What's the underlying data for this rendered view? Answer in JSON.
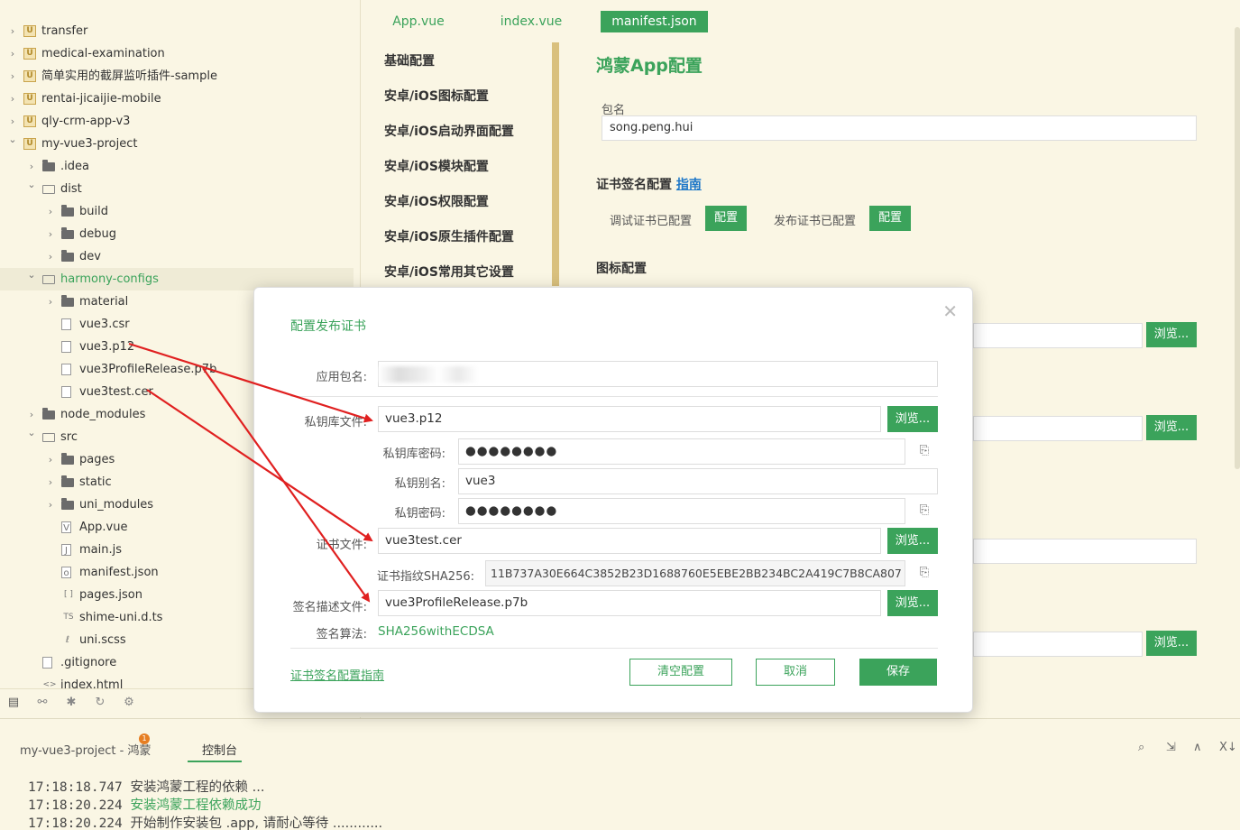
{
  "sidebar": {
    "tree": [
      {
        "label": "transfer",
        "icon": "project-u-icon",
        "chevron": "›"
      },
      {
        "label": "medical-examination",
        "icon": "project-u-icon",
        "chevron": "›"
      },
      {
        "label": "简单实用的截屏监听插件-sample",
        "icon": "project-u-icon",
        "chevron": "›"
      },
      {
        "label": "rentai-jicaijie-mobile",
        "icon": "project-u-icon",
        "chevron": "›"
      },
      {
        "label": "qly-crm-app-v3",
        "icon": "project-u-icon",
        "chevron": "›"
      },
      {
        "label": "my-vue3-project",
        "icon": "project-u-icon",
        "chevron": "⌄"
      },
      {
        "label": ".idea",
        "icon": "folder-icon",
        "chevron": "›"
      },
      {
        "label": "dist",
        "icon": "folder-open-icon",
        "chevron": "⌄"
      },
      {
        "label": "build",
        "icon": "folder-icon",
        "chevron": "›"
      },
      {
        "label": "debug",
        "icon": "folder-icon",
        "chevron": "›"
      },
      {
        "label": "dev",
        "icon": "folder-icon",
        "chevron": "›"
      },
      {
        "label": "harmony-configs",
        "icon": "folder-open-icon",
        "chevron": "⌄"
      },
      {
        "label": "material",
        "icon": "folder-icon",
        "chevron": "›"
      },
      {
        "label": "vue3.csr",
        "icon": "file-icon",
        "chevron": ""
      },
      {
        "label": "vue3.p12",
        "icon": "file-icon",
        "chevron": ""
      },
      {
        "label": "vue3ProfileRelease.p7b",
        "icon": "file-icon",
        "chevron": ""
      },
      {
        "label": "vue3test.cer",
        "icon": "file-icon",
        "chevron": ""
      },
      {
        "label": "node_modules",
        "icon": "folder-icon",
        "chevron": "›"
      },
      {
        "label": "src",
        "icon": "folder-open-icon",
        "chevron": "⌄"
      },
      {
        "label": "pages",
        "icon": "folder-icon",
        "chevron": "›"
      },
      {
        "label": "static",
        "icon": "folder-icon",
        "chevron": "›"
      },
      {
        "label": "uni_modules",
        "icon": "folder-icon",
        "chevron": "›"
      },
      {
        "label": "App.vue",
        "icon": "vue-file-icon",
        "chevron": ""
      },
      {
        "label": "main.js",
        "icon": "js-file-icon",
        "chevron": ""
      },
      {
        "label": "manifest.json",
        "icon": "json-file-icon",
        "chevron": ""
      },
      {
        "label": "pages.json",
        "icon": "json-bracket-icon",
        "chevron": ""
      },
      {
        "label": "shime-uni.d.ts",
        "icon": "ts-file-icon",
        "chevron": ""
      },
      {
        "label": "uni.scss",
        "icon": "scss-file-icon",
        "chevron": ""
      },
      {
        "label": ".gitignore",
        "icon": "file-icon",
        "chevron": ""
      },
      {
        "label": "index.html",
        "icon": "html-file-icon",
        "chevron": ""
      }
    ]
  },
  "editor": {
    "tabs": [
      {
        "label": "App.vue"
      },
      {
        "label": "index.vue"
      },
      {
        "label": "manifest.json"
      }
    ],
    "menu": [
      {
        "label": "基础配置"
      },
      {
        "label": "安卓/iOS图标配置"
      },
      {
        "label": "安卓/iOS启动界面配置"
      },
      {
        "label": "安卓/iOS模块配置"
      },
      {
        "label": "安卓/iOS权限配置"
      },
      {
        "label": "安卓/iOS原生插件配置"
      },
      {
        "label": "安卓/iOS常用其它设置"
      }
    ],
    "title": "鸿蒙App配置",
    "package_label": "包名",
    "package_value": "song.peng.hui",
    "cert_section": "证书签名配置",
    "cert_guide": "指南",
    "debug_cert": "调试证书已配置",
    "release_cert": "发布证书已配置",
    "config_btn": "配置",
    "icon_section": "图标配置",
    "browse_btn": "浏览..."
  },
  "dialog": {
    "title": "配置发布证书",
    "app_package_label": "应用包名:",
    "keystore_label": "私钥库文件:",
    "keystore_value": "vue3.p12",
    "keystore_pwd_label": "私钥库密码:",
    "keystore_pwd_value": "●●●●●●●●",
    "alias_label": "私钥别名:",
    "alias_value": "vue3",
    "key_pwd_label": "私钥密码:",
    "key_pwd_value": "●●●●●●●●",
    "cert_label": "证书文件:",
    "cert_value": "vue3test.cer",
    "fingerprint_label": "证书指纹SHA256:",
    "fingerprint_value": "11B737A30E664C3852B23D1688760E5EBE2BB234BC2A419C7B8CA807",
    "profile_label": "签名描述文件:",
    "profile_value": "vue3ProfileRelease.p7b",
    "algo_label": "签名算法:",
    "algo_value": "SHA256withECDSA",
    "browse_btn": "浏览...",
    "guide_link": "证书签名配置指南",
    "clear_btn": "清空配置",
    "cancel_btn": "取消",
    "save_btn": "保存"
  },
  "bottom": {
    "project_tab": "my-vue3-project - 鸿蒙",
    "badge": "1",
    "console_tab": "控制台",
    "logs": [
      {
        "time": "17:18:18.747",
        "msg": "安装鸿蒙工程的依赖 ...",
        "ok": false
      },
      {
        "time": "17:18:20.224",
        "msg": "安装鸿蒙工程依赖成功",
        "ok": true
      },
      {
        "time": "17:18:20.224",
        "msg": "开始制作安装包 .app, 请耐心等待 ............",
        "ok": false
      }
    ]
  },
  "colors": {
    "accent": "#3ba35b",
    "background": "#faf6e4",
    "arrow": "#e02020"
  }
}
